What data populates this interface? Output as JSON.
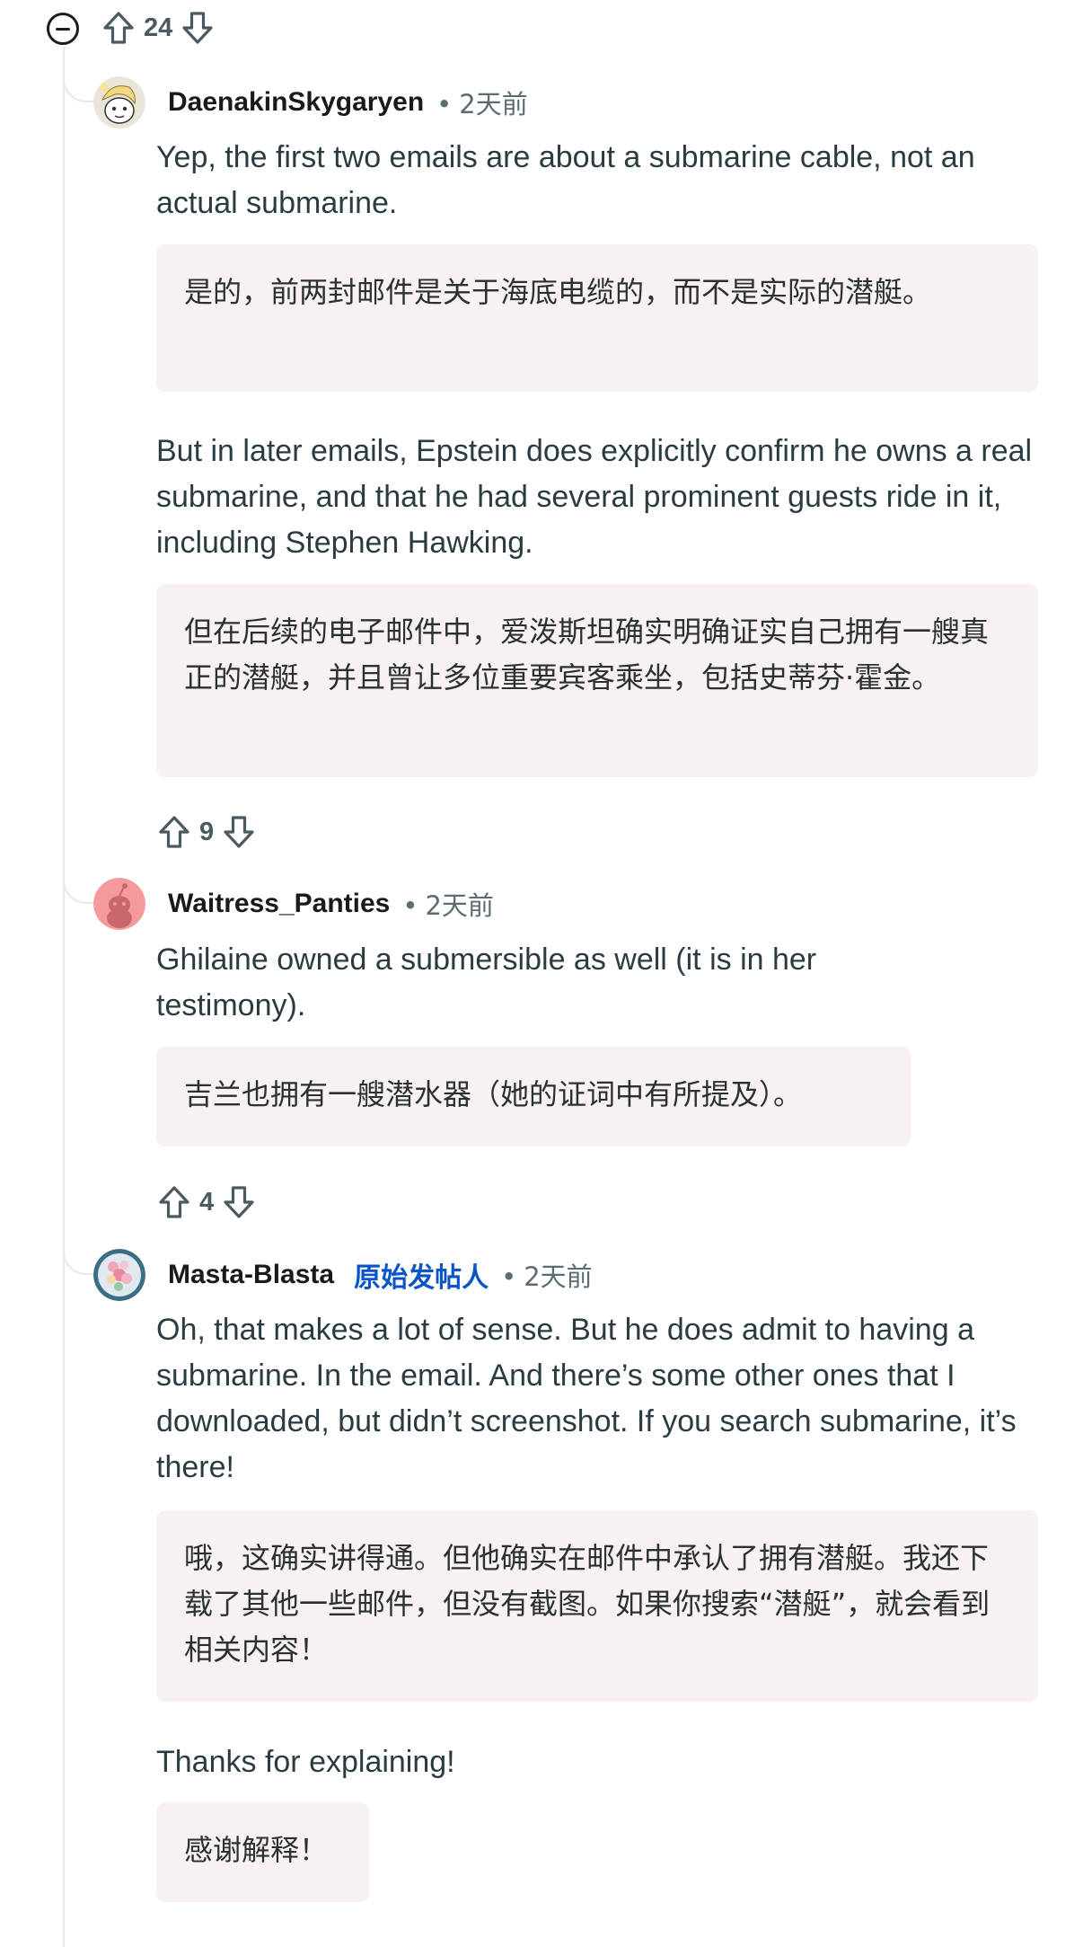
{
  "parent_votes": {
    "count": "24"
  },
  "comments": [
    {
      "username": "DaenakinSkygaryen",
      "time": "2天前",
      "paragraphs": [
        {
          "original": "Yep, the first two emails are about a submarine cable, not an actual submarine.",
          "translation": "是的，前两封邮件是关于海底电缆的，而不是实际的潜艇。"
        },
        {
          "original": "But in later emails, Epstein does explicitly confirm he owns a real submarine, and that he had several prominent guests ride in it, including Stephen Hawking.",
          "translation": "但在后续的电子邮件中，爱泼斯坦确实明确证实自己拥有一艘真正的潜艇，并且曾让多位重要宾客乘坐，包括史蒂芬·霍金。"
        }
      ],
      "votes": "9"
    },
    {
      "username": "Waitress_Panties",
      "time": "2天前",
      "paragraphs": [
        {
          "original": "Ghilaine owned a submersible as well (it is in her testimony).",
          "translation": "吉兰也拥有一艘潜水器（她的证词中有所提及）。"
        }
      ],
      "votes": "4"
    },
    {
      "username": "Masta-Blasta",
      "op_badge": "原始发帖人",
      "time": "2天前",
      "paragraphs": [
        {
          "original": "Oh, that makes a lot of sense. But he does admit to having a submarine. In the email. And there’s some other ones that I downloaded, but didn’t screenshot. If you search submarine, it’s there!",
          "translation": "哦，这确实讲得通。但他确实在邮件中承认了拥有潜艇。我还下载了其他一些邮件，但没有截图。如果你搜索“潜艇”，就会看到相关内容！"
        },
        {
          "original": "Thanks for explaining!",
          "translation": "感谢解释！"
        }
      ]
    }
  ],
  "colors": {
    "background": "#ffffff",
    "translation_bg": "#f8f1f1",
    "op_badge": "#0a56c9",
    "thread_line": "#e5e7e8"
  },
  "icons": [
    "collapse-icon",
    "upvote-icon",
    "downvote-icon",
    "avatar"
  ]
}
